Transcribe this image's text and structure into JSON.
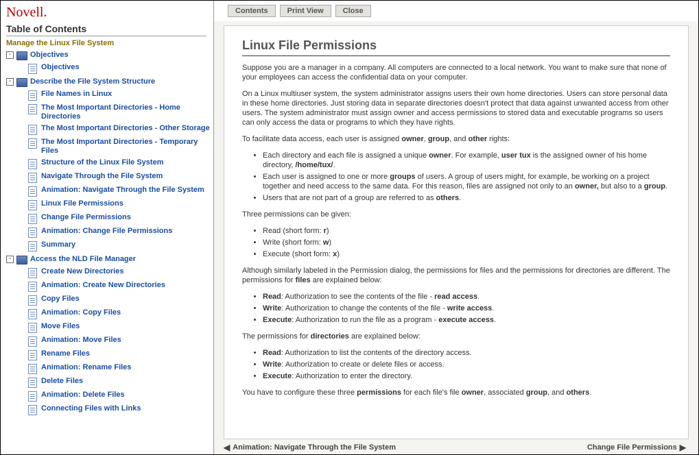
{
  "brand": "Novell",
  "toc_title": "Table of Contents",
  "course_title": "Manage the Linux File System",
  "sections": [
    {
      "label": "Objectives",
      "items": [
        {
          "label": "Objectives"
        }
      ]
    },
    {
      "label": "Describe the File System Structure",
      "items": [
        {
          "label": "File Names in Linux"
        },
        {
          "label": "The Most Important Directories - Home Directories"
        },
        {
          "label": "The Most Important Directories - Other Storage"
        },
        {
          "label": "The Most Important Directories - Temporary Files"
        },
        {
          "label": "Structure of the Linux File System"
        },
        {
          "label": "Navigate Through the File System"
        },
        {
          "label": "Animation: Navigate Through the File System"
        },
        {
          "label": "Linux File Permissions"
        },
        {
          "label": "Change File Permissions"
        },
        {
          "label": "Animation: Change File Permissions"
        },
        {
          "label": "Summary"
        }
      ]
    },
    {
      "label": "Access the NLD File Manager",
      "items": [
        {
          "label": "Create New Directories"
        },
        {
          "label": "Animation: Create New Directories"
        },
        {
          "label": "Copy Files"
        },
        {
          "label": "Animation: Copy Files"
        },
        {
          "label": "Move Files"
        },
        {
          "label": "Animation: Move Files"
        },
        {
          "label": "Rename Files"
        },
        {
          "label": "Animation: Rename Files"
        },
        {
          "label": "Delete Files"
        },
        {
          "label": "Animation: Delete Files"
        },
        {
          "label": "Connecting Files with Links"
        }
      ]
    }
  ],
  "toolbar": {
    "contents": "Contents",
    "print": "Print View",
    "close": "Close"
  },
  "page": {
    "title": "Linux File Permissions",
    "p1": "Suppose you are a manager in a company. All computers are connected to a local network. You want to make sure that none of your employees can access the confidential data on your computer.",
    "p2": "On a Linux multiuser system, the system administrator assigns users their own home directories. Users can store personal data in these home directories. Just storing data in separate directories doesn't protect that data against unwanted access from other users. The system administrator must assign owner and access permissions to stored data and executable programs so users can only access the data or programs to which they have rights.",
    "p3_a": "To facilitate data access, each user is assigned ",
    "p3_b1": "owner",
    "p3_c": ", ",
    "p3_b2": "group",
    "p3_d": ", and ",
    "p3_b3": "other",
    "p3_e": " rights:",
    "bul1_a": "Each directory and each file is assigned a unique ",
    "bul1_b1": "owner",
    "bul1_b": ". For example, ",
    "bul1_b2": "user tux",
    "bul1_c": " is the assigned owner of his home directory, ",
    "bul1_b3": "/home/tux/",
    "bul1_d": ".",
    "bul2_a": "Each user is assigned to one or more ",
    "bul2_b1": "groups",
    "bul2_b": " of users. A group of users might, for example, be working on a project together and need access to the same data. For this reason, files are assigned not only to an ",
    "bul2_b2": "owner,",
    "bul2_c": " but also to a ",
    "bul2_b3": "group",
    "bul2_d": ".",
    "bul3_a": "Users that are not part of a group are referred to as ",
    "bul3_b1": "others",
    "bul3_b": ".",
    "p4": "Three permissions can be given:",
    "perm_r_a": "Read (short form: ",
    "perm_r_b": "r",
    "perm_r_c": ")",
    "perm_w_a": "Write (short form: ",
    "perm_w_b": "w",
    "perm_w_c": ")",
    "perm_x_a": "Execute (short form: ",
    "perm_x_b": "x",
    "perm_x_c": ")",
    "p5_a": "Although similarly labeled in the Permission dialog, the permissions for files and the permissions for directories are different. The permissions for ",
    "p5_b": "files",
    "p5_c": " are explained below:",
    "file_r_a": "Read",
    "file_r_b": ": Authorization to see the contents of the file - ",
    "file_r_c": "read access",
    "file_r_d": ".",
    "file_w_a": "Write",
    "file_w_b": ": Authorization to change the contents of the file - ",
    "file_w_c": "write access",
    "file_w_d": ".",
    "file_x_a": "Execute",
    "file_x_b": ": Authorization to run the file as a program - ",
    "file_x_c": "execute access",
    "file_x_d": ".",
    "p6_a": "The permissions for ",
    "p6_b": "directories",
    "p6_c": " are explained below:",
    "dir_r_a": "Read",
    "dir_r_b": ": Authorization to list the contents of the directory access.",
    "dir_w_a": "Write",
    "dir_w_b": ": Authorization to create or delete files or access.",
    "dir_x_a": "Execute",
    "dir_x_b": ": Authorization to enter the directory.",
    "p7_a": "You have to configure these three ",
    "p7_b": "permissions",
    "p7_c": " for each file's file ",
    "p7_d": "owner",
    "p7_e": ", associated ",
    "p7_f": "group",
    "p7_g": ", and ",
    "p7_h": "others",
    "p7_i": "."
  },
  "footer": {
    "prev": "Animation: Navigate Through the File System",
    "next": "Change File Permissions"
  }
}
